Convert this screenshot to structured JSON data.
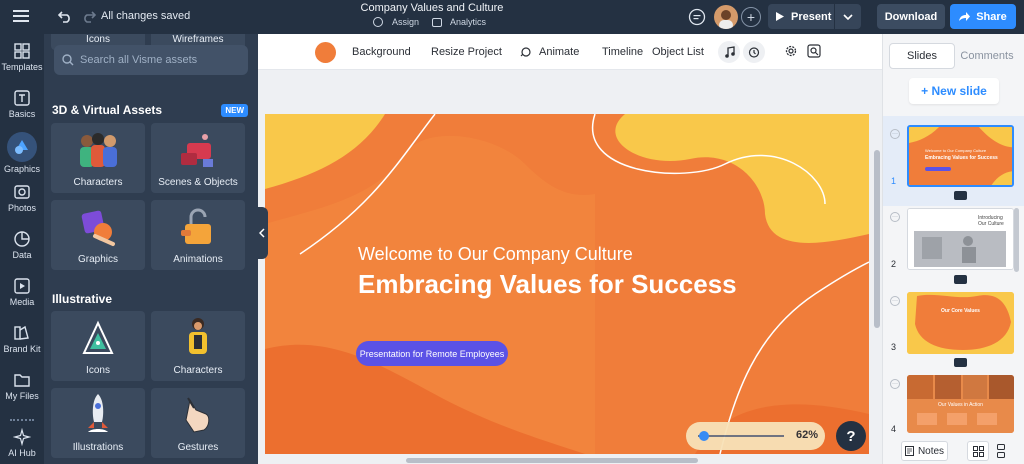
{
  "header": {
    "status": "All changes saved",
    "project_title": "Company Values and Culture",
    "assign_label": "Assign",
    "analytics_label": "Analytics",
    "present_label": "Present",
    "download_label": "Download",
    "share_label": "Share"
  },
  "leftnav": {
    "items": [
      {
        "label": "Templates",
        "icon": "templates-icon"
      },
      {
        "label": "Basics",
        "icon": "basics-icon"
      },
      {
        "label": "Graphics",
        "icon": "graphics-icon"
      },
      {
        "label": "Photos",
        "icon": "photos-icon"
      },
      {
        "label": "Data",
        "icon": "data-icon"
      },
      {
        "label": "Media",
        "icon": "media-icon"
      },
      {
        "label": "Brand Kit",
        "icon": "brand-kit-icon"
      },
      {
        "label": "My Files",
        "icon": "my-files-icon"
      },
      {
        "label": "AI Hub",
        "icon": "ai-hub-icon"
      }
    ]
  },
  "assets": {
    "search_placeholder": "Search all Visme assets",
    "partial_labels": [
      "Icons",
      "Wireframes"
    ],
    "section_3d": "3D & Virtual Assets",
    "badge_new": "NEW",
    "tiles_3d": [
      "Characters",
      "Scenes & Objects",
      "Graphics",
      "Animations"
    ],
    "section_illustrative": "Illustrative",
    "tiles_illustrative": [
      "Icons",
      "Characters",
      "Illustrations",
      "Gestures"
    ]
  },
  "toolbar": {
    "background_label": "Background",
    "resize_label": "Resize Project",
    "animate_label": "Animate",
    "timeline_label": "Timeline",
    "object_list_label": "Object List",
    "bg_color": "#f07d3a"
  },
  "slide": {
    "subtitle": "Welcome to Our Company Culture",
    "title": "Embracing Values for Success",
    "pill": "Presentation for Remote Employees",
    "zoom": "62%",
    "help": "?"
  },
  "right_panel": {
    "tab_slides": "Slides",
    "tab_comments": "Comments",
    "new_slide": "+ New slide",
    "thumbs": [
      {
        "num": "1",
        "line1": "Welcome to Our Company Culture",
        "line2": "Embracing Values for Success"
      },
      {
        "num": "2",
        "line1": "Introducing",
        "line2": "Our Culture"
      },
      {
        "num": "3",
        "line1": "Our Core Values",
        "line2": ""
      },
      {
        "num": "4",
        "line1": "Our Values in Action",
        "line2": ""
      }
    ],
    "notes_label": "Notes"
  },
  "colors": {
    "accent_blue": "#2d8cff",
    "slide_orange": "#f07d3a",
    "slide_yellow": "#f9c84a",
    "pill_purple": "#5b52e6"
  }
}
